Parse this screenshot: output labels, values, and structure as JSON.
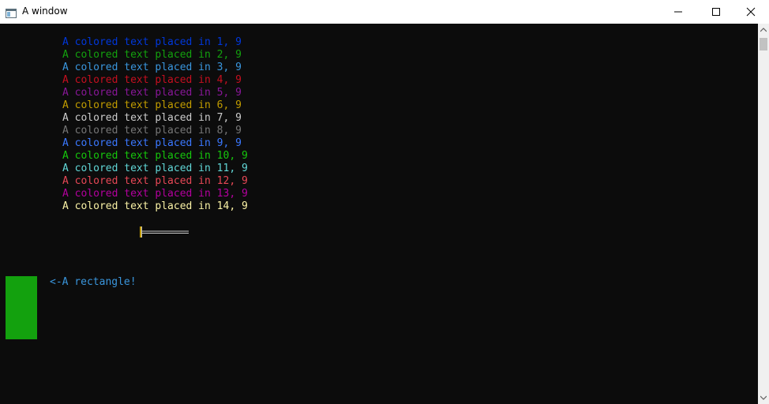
{
  "window": {
    "title": "A window",
    "icon": "console-window-icon",
    "controls": [
      "minimize-icon",
      "maximize-icon",
      "close-icon"
    ]
  },
  "console": {
    "background": "#0c0c0c",
    "lines": [
      {
        "text": "A colored text placed in 1, 9",
        "color": "#0037da"
      },
      {
        "text": "A colored text placed in 2, 9",
        "color": "#13a10e"
      },
      {
        "text": "A colored text placed in 3, 9",
        "color": "#3a96dd"
      },
      {
        "text": "A colored text placed in 4, 9",
        "color": "#c50f1f"
      },
      {
        "text": "A colored text placed in 5, 9",
        "color": "#881798"
      },
      {
        "text": "A colored text placed in 6, 9",
        "color": "#c19c00"
      },
      {
        "text": "A colored text placed in 7, 9",
        "color": "#cccccc"
      },
      {
        "text": "A colored text placed in 8, 9",
        "color": "#767676"
      },
      {
        "text": "A colored text placed in 9, 9",
        "color": "#3b78ff"
      },
      {
        "text": "A colored text placed in 10, 9",
        "color": "#16c60c"
      },
      {
        "text": "A colored text placed in 11, 9",
        "color": "#61d6d6"
      },
      {
        "text": "A colored text placed in 12, 9",
        "color": "#e74856"
      },
      {
        "text": "A colored text placed in 13, 9",
        "color": "#b4009e"
      },
      {
        "text": "A colored text placed in 14, 9",
        "color": "#f9f1a5"
      }
    ],
    "rectangle": {
      "color": "#13a10e",
      "label": "<-A rectangle!",
      "label_color": "#3a96dd"
    }
  },
  "scrollbar": {
    "up_icon": "scroll-up-arrow-icon",
    "down_icon": "scroll-down-arrow-icon"
  }
}
